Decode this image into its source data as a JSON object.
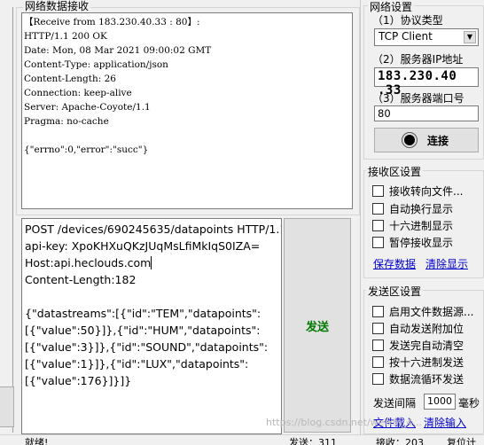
{
  "receive": {
    "title": "网络数据接收",
    "lines": [
      "【Receive from 183.230.40.33 : 80】:",
      "HTTP/1.1 200 OK",
      "Date: Mon, 08 Mar 2021 09:00:02 GMT",
      "Content-Type: application/json",
      "Content-Length: 26",
      "Connection: keep-alive",
      "Server: Apache-Coyote/1.1",
      "Pragma: no-cache",
      "",
      "{\"errno\":0,\"error\":\"succ\"}"
    ]
  },
  "send": {
    "lines": [
      "POST /devices/690245635/datapoints HTTP/1.1",
      "api-key: XpoKHXuQKzJUqMsLfiMkIqS0IZA=",
      "Host:api.heclouds.com",
      "Content-Length:182",
      "",
      "{\"datastreams\":[{\"id\":\"TEM\",\"datapoints\":",
      "[{\"value\":50}]},{\"id\":\"HUM\",\"datapoints\":",
      "[{\"value\":3}]},{\"id\":\"SOUND\",\"datapoints\":",
      "[{\"value\":1}]},{\"id\":\"LUX\",\"datapoints\":",
      "[{\"value\":176}]}]}"
    ],
    "button_label": "发送"
  },
  "network": {
    "title": "网络设置",
    "protocol_label": "（1）协议类型",
    "protocol_value": "TCP Client",
    "ip_label": "（2）服务器IP地址",
    "ip_value": "183.230.40 .33",
    "port_label": "（3）服务器端口号",
    "port_value": "80",
    "connect_label": "连接"
  },
  "receive_settings": {
    "title": "接收区设置",
    "options": [
      "接收转向文件...",
      "自动换行显示",
      "十六进制显示",
      "暂停接收显示"
    ],
    "save_link": "保存数据",
    "clear_link": "清除显示"
  },
  "send_settings": {
    "title": "发送区设置",
    "options": [
      "启用文件数据源...",
      "自动发送附加位",
      "发送完自动清空",
      "按十六进制发送",
      "数据流循环发送"
    ],
    "interval_label": "发送间隔",
    "interval_value": "1000",
    "interval_unit": "毫秒",
    "load_link": "文件载入",
    "clear_link": "清除输入"
  },
  "status": {
    "ready": "就绪!",
    "send_count": "发送：311",
    "recv_count": "接收：203",
    "reset": "复位计"
  },
  "watermark": "https://blog.csdn.net/weixin_4..."
}
